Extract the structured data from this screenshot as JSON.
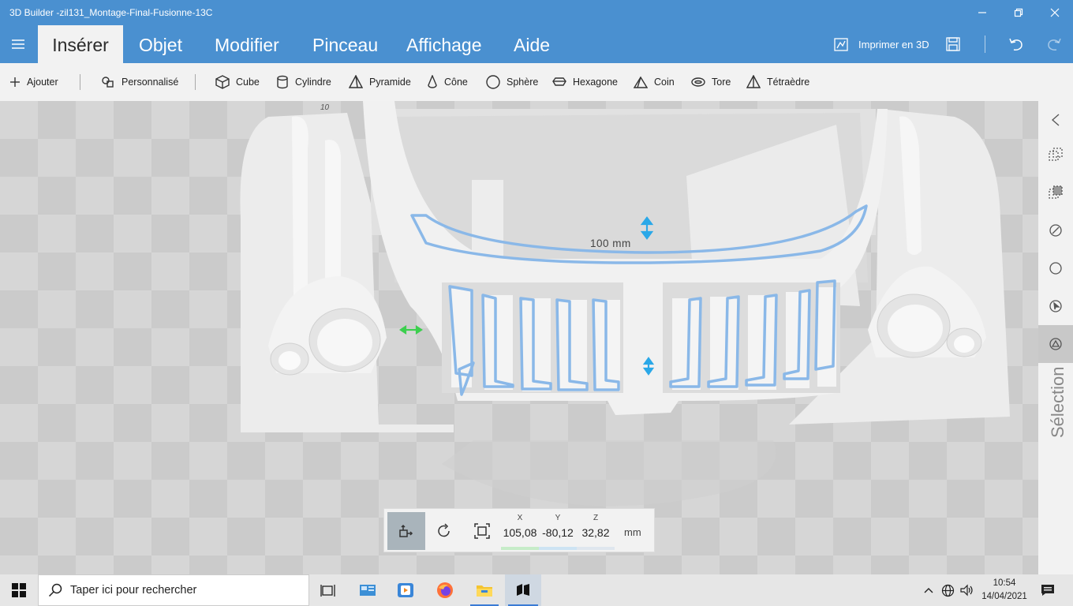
{
  "window": {
    "title": "3D Builder -zil131_Montage-Final-Fusionne-13C"
  },
  "ribbon": {
    "tabs": [
      "Insérer",
      "Objet",
      "Modifier",
      "Pinceau",
      "Affichage",
      "Aide"
    ],
    "active_tab": "Insérer",
    "print_label": "Imprimer en 3D"
  },
  "toolbar": {
    "items": [
      "Ajouter",
      "Personnalisé",
      "Cube",
      "Cylindre",
      "Pyramide",
      "Cône",
      "Sphère",
      "Hexagone",
      "Coin",
      "Tore",
      "Tétraèdre"
    ]
  },
  "viewport": {
    "dimension_label": "100 mm",
    "corner_label": "10"
  },
  "side_panel": {
    "label": "Sélection"
  },
  "transform": {
    "x_label": "X",
    "x_value": "105,08",
    "y_label": "Y",
    "y_value": "-80,12",
    "z_label": "Z",
    "z_value": "32,82",
    "unit": "mm"
  },
  "taskbar": {
    "search_placeholder": "Taper ici pour rechercher",
    "time": "10:54",
    "date": "14/04/2021"
  },
  "colors": {
    "accent": "#4a90d0",
    "selection_outline": "#8ab8e8",
    "arrow_blue": "#2aa8e8",
    "arrow_green": "#3ccf4e"
  }
}
